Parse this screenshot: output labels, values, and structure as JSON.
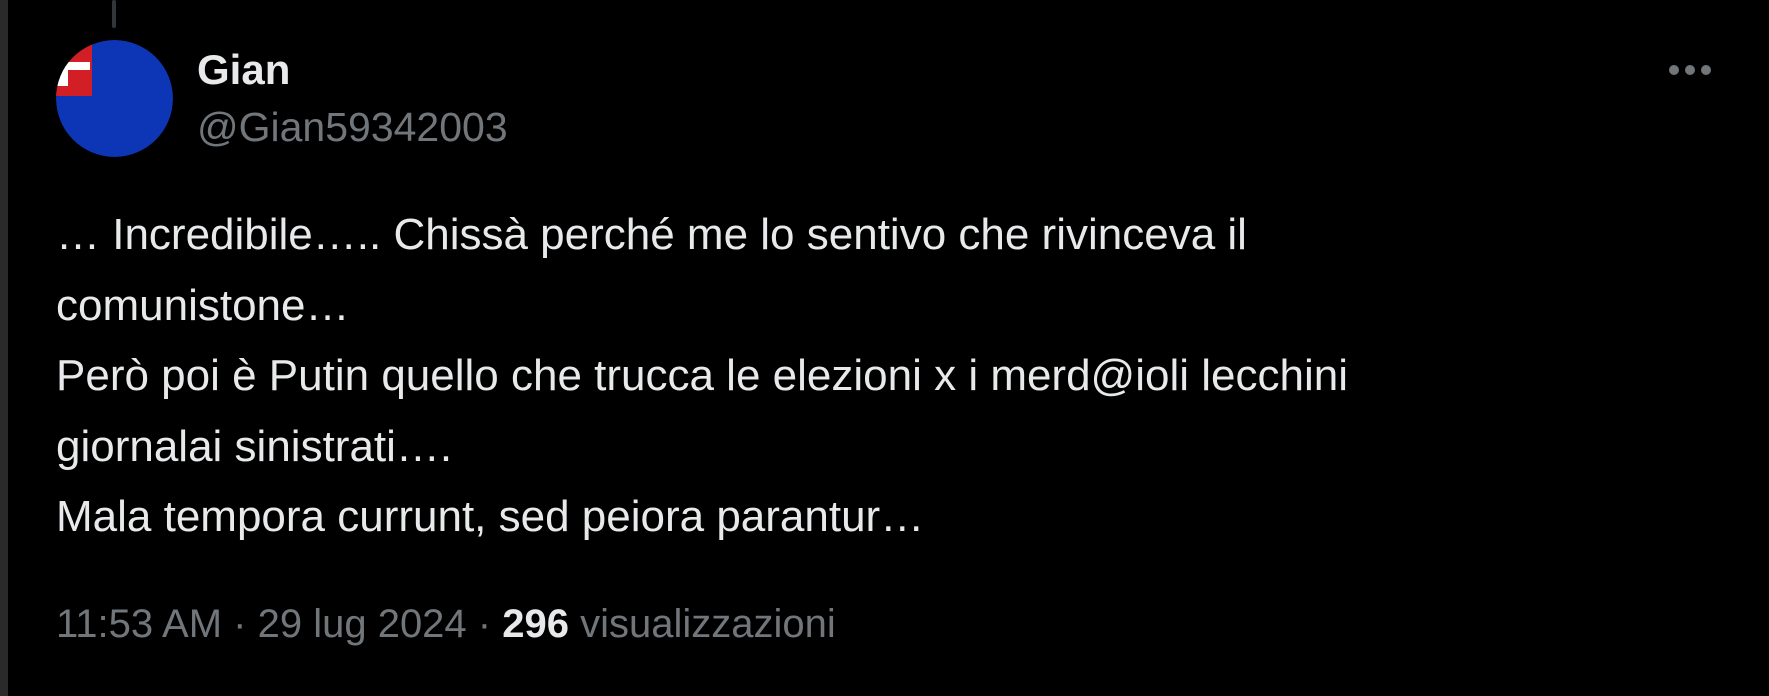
{
  "tweet": {
    "author": {
      "display_name": "Gian",
      "handle": "@Gian59342003",
      "avatar_colors": {
        "background": "#0d36b6",
        "flag_red": "#d21f26",
        "flag_white": "#ffffff"
      }
    },
    "more_icon": "more-horizontal-icon",
    "text_lines": [
      "… Incredibile….. Chissà perché me lo sentivo che rivinceva il",
      "comunistone…",
      "Però poi è Putin quello che trucca le elezioni x i merd@ioli lecchini",
      "giornalai sinistrati….",
      "Mala tempora currunt, sed peiora parantur…"
    ],
    "time": "11:53 AM",
    "separator": " · ",
    "date": "29 lug 2024",
    "views_count": "296",
    "views_label": "visualizzazioni"
  },
  "colors": {
    "background": "#000000",
    "primary_text": "#e7e9ea",
    "secondary_text": "#71767b"
  }
}
